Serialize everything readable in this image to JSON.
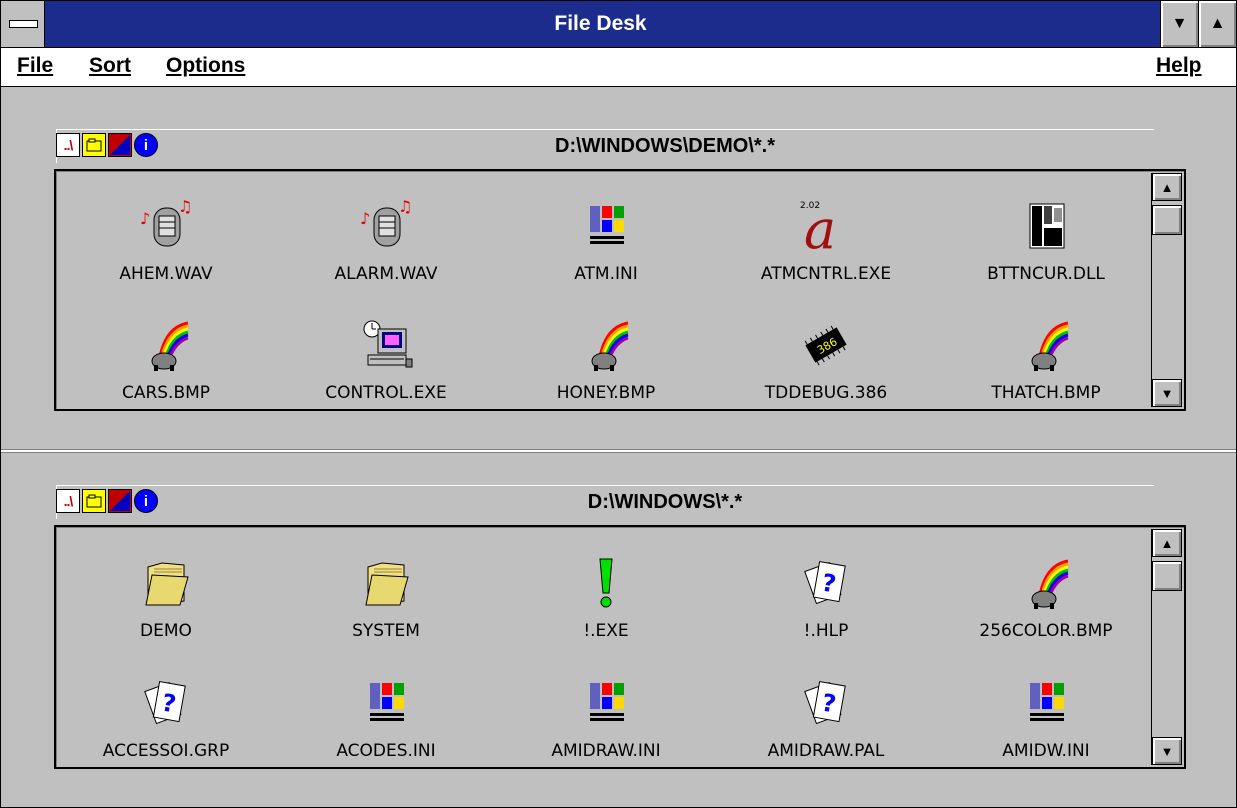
{
  "window": {
    "title": "File Desk"
  },
  "menubar": {
    "file": "File",
    "sort": "Sort",
    "options": "Options",
    "help": "Help"
  },
  "panes": [
    {
      "path": "D:\\WINDOWS\\DEMO\\*.*",
      "items": [
        {
          "label": "AHEM.WAV",
          "icon": "sound-file-icon"
        },
        {
          "label": "ALARM.WAV",
          "icon": "sound-file-icon"
        },
        {
          "label": "ATM.INI",
          "icon": "windows-logo-icon"
        },
        {
          "label": "ATMCNTRL.EXE",
          "icon": "atm-app-icon"
        },
        {
          "label": "BTTNCUR.DLL",
          "icon": "dll-file-icon"
        },
        {
          "label": "CARS.BMP",
          "icon": "paint-bitmap-icon"
        },
        {
          "label": "CONTROL.EXE",
          "icon": "control-panel-icon"
        },
        {
          "label": "HONEY.BMP",
          "icon": "paint-bitmap-icon"
        },
        {
          "label": "TDDEBUG.386",
          "icon": "chip-386-icon"
        },
        {
          "label": "THATCH.BMP",
          "icon": "paint-bitmap-icon"
        }
      ]
    },
    {
      "path": "D:\\WINDOWS\\*.*",
      "items": [
        {
          "label": "DEMO",
          "icon": "folder-icon"
        },
        {
          "label": "SYSTEM",
          "icon": "folder-icon"
        },
        {
          "label": "!.EXE",
          "icon": "exclamation-icon"
        },
        {
          "label": "!.HLP",
          "icon": "unknown-file-icon"
        },
        {
          "label": "256COLOR.BMP",
          "icon": "paint-bitmap-icon"
        },
        {
          "label": "ACCESSOI.GRP",
          "icon": "unknown-file-icon"
        },
        {
          "label": "ACODES.INI",
          "icon": "windows-logo-icon"
        },
        {
          "label": "AMIDRAW.INI",
          "icon": "windows-logo-icon"
        },
        {
          "label": "AMIDRAW.PAL",
          "icon": "unknown-file-icon"
        },
        {
          "label": "AMIDW.INI",
          "icon": "windows-logo-icon"
        }
      ]
    }
  ],
  "toolbar_icons": [
    "parent-dir-icon",
    "new-folder-icon",
    "attributes-icon",
    "info-icon"
  ],
  "colors": {
    "titlebar": "#1c2c8c",
    "face": "#c0c0c0",
    "menu": "#ffffff"
  }
}
